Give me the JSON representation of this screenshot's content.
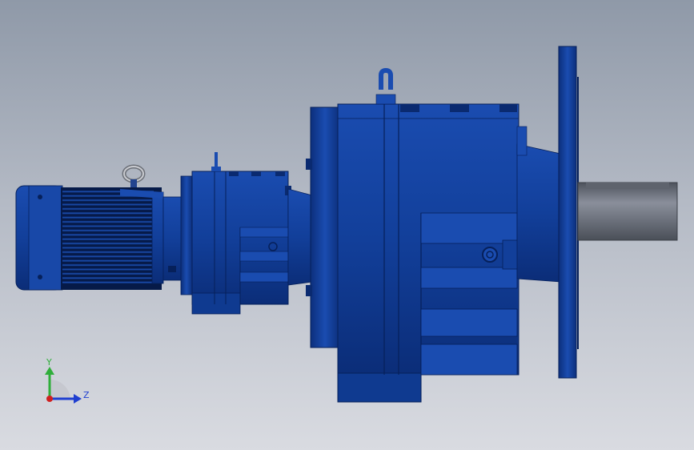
{
  "viewport": {
    "background_top": "#8f99a8",
    "background_bottom": "#dadce2",
    "model_color": "#123f9a",
    "model_dark": "#0a2a70",
    "shaft_color": "#6e7380"
  },
  "triad": {
    "y_label": "Y",
    "z_label": "Z",
    "y_color": "#2fae3a",
    "z_color": "#1f3fd0",
    "x_color": "#d02020",
    "icon": "coordinate-triad-icon"
  }
}
